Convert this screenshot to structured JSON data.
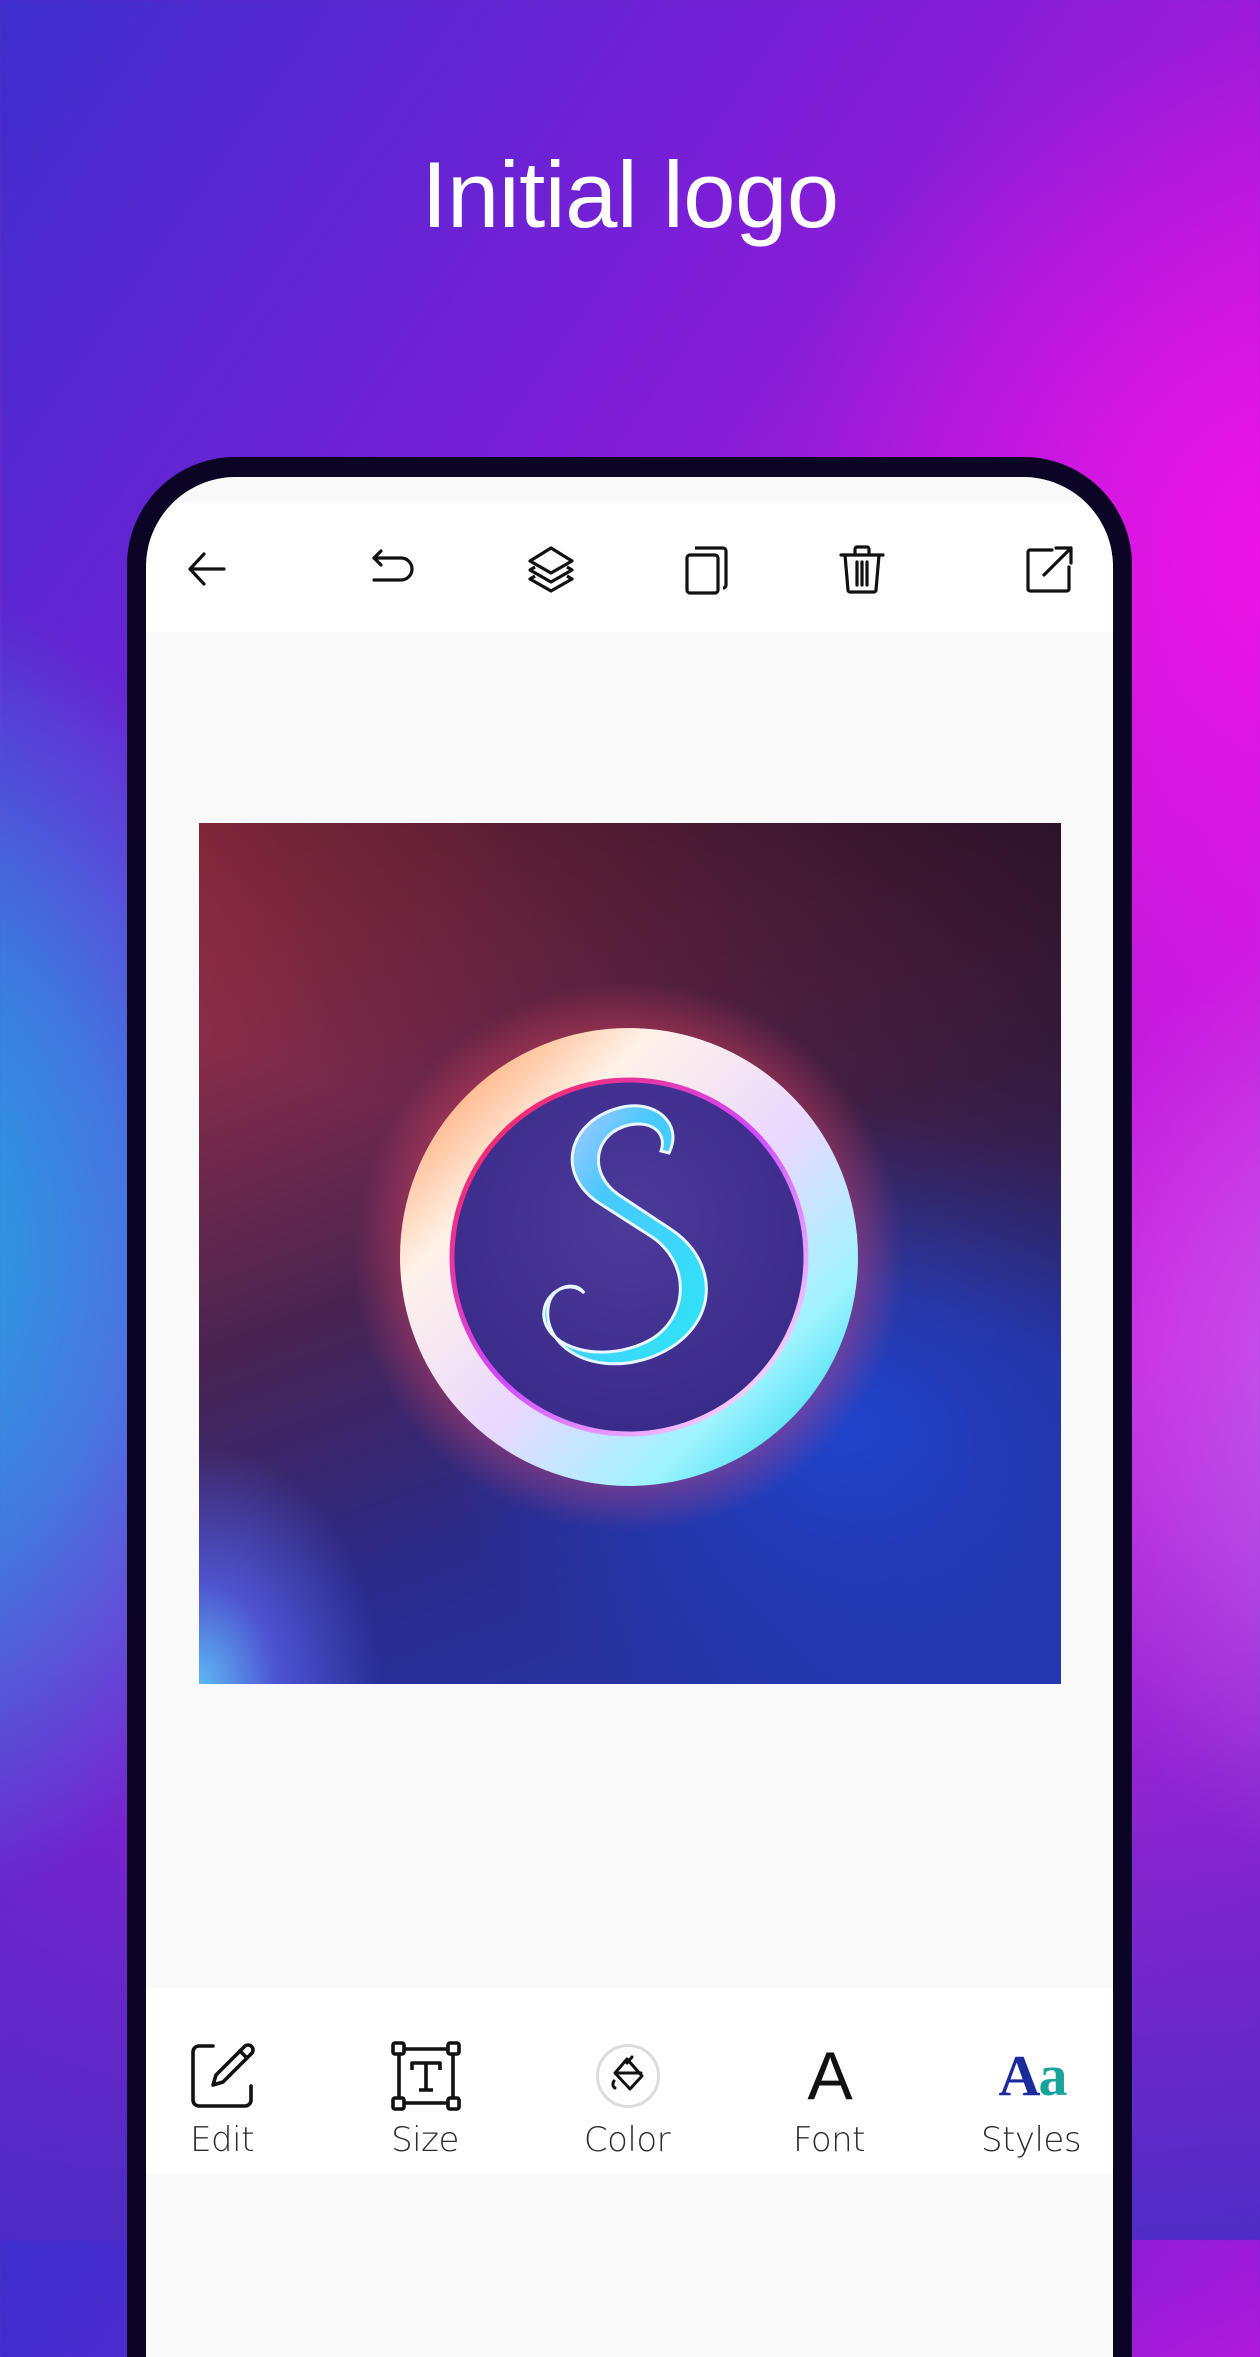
{
  "headline": "Initial logo",
  "colors": {
    "phone_frame": "#0c0424",
    "screen_background": "#f9f9f9",
    "toolbar_background": "#ffffff",
    "icon_stroke": "#111111",
    "label_text": "#2b2b2b",
    "styles_icon_primary": "#1b2b9c",
    "styles_icon_secondary": "#1aa39b",
    "logo_ring": "#f3e9ff",
    "logo_letter": "#3fdcf2"
  },
  "top_toolbar": {
    "items": [
      {
        "id": "back",
        "icon": "arrow-left-icon"
      },
      {
        "id": "undo",
        "icon": "undo-icon"
      },
      {
        "id": "layers",
        "icon": "layers-icon"
      },
      {
        "id": "duplicate",
        "icon": "copy-icon"
      },
      {
        "id": "delete",
        "icon": "trash-icon"
      },
      {
        "id": "export",
        "icon": "share-external-icon"
      }
    ]
  },
  "canvas": {
    "logo_letter": "S",
    "logo_description": "Neon glowing ring with cursive letter S on red-to-blue gradient"
  },
  "bottom_toolbar": {
    "items": [
      {
        "id": "edit",
        "label": "Edit",
        "icon": "edit-pencil-icon"
      },
      {
        "id": "size",
        "label": "Size",
        "icon": "text-size-box-icon"
      },
      {
        "id": "color",
        "label": "Color",
        "icon": "paint-bucket-icon"
      },
      {
        "id": "font",
        "label": "Font",
        "icon": "font-letter-icon",
        "glyph": "A"
      },
      {
        "id": "styles",
        "label": "Styles",
        "icon": "styles-aa-icon",
        "glyph_upper": "A",
        "glyph_lower": "a"
      }
    ]
  }
}
